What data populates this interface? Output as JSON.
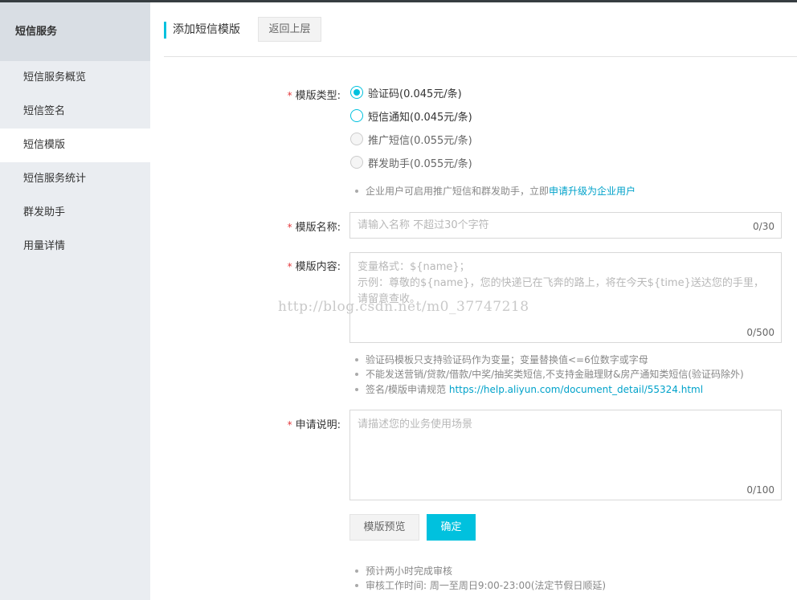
{
  "sidebar": {
    "title": "短信服务",
    "items": [
      {
        "label": "短信服务概览"
      },
      {
        "label": "短信签名"
      },
      {
        "label": "短信模版"
      },
      {
        "label": "短信服务统计"
      },
      {
        "label": "群发助手"
      },
      {
        "label": "用量详情"
      }
    ]
  },
  "header": {
    "title": "添加短信模版",
    "back_label": "返回上层"
  },
  "form": {
    "type": {
      "label": "模版类型:",
      "options": [
        {
          "label": "验证码(0.045元/条)"
        },
        {
          "label": "短信通知(0.045元/条)"
        },
        {
          "label": "推广短信(0.055元/条)"
        },
        {
          "label": "群发助手(0.055元/条)"
        }
      ],
      "tip_prefix": "企业用户可启用推广短信和群发助手，立即",
      "tip_link": "申请升级为企业用户"
    },
    "name": {
      "label": "模版名称:",
      "placeholder": "请输入名称 不超过30个字符",
      "count": "0/30"
    },
    "content": {
      "label": "模版内容:",
      "placeholder_line1": "变量格式：${name}；",
      "placeholder_line2": "示例：尊敬的${name}，您的快递已在飞奔的路上，将在今天${time}送达您的手里，请留意查收。",
      "count": "0/500",
      "tips": [
        {
          "text": "验证码模板只支持验证码作为变量；变量替换值<=6位数字或字母"
        },
        {
          "text": "不能发送营销/贷款/借款/中奖/抽奖类短信,不支持金融理财&房产通知类短信(验证码除外)"
        }
      ],
      "tip3_prefix": "签名/模版申请规范 ",
      "tip3_link": "https://help.aliyun.com/document_detail/55324.html"
    },
    "desc": {
      "label": "申请说明:",
      "placeholder": "请描述您的业务使用场景",
      "count": "0/100"
    },
    "preview_label": "模版预览",
    "submit_label": "确定",
    "bottom_tips": [
      {
        "text": "预计两小时完成审核"
      },
      {
        "text": "审核工作时间: 周一至周日9:00-23:00(法定节假日顺延)"
      }
    ]
  },
  "watermark": "http://blog.csdn.net/m0_37747218",
  "colors": {
    "accent": "#00c1de",
    "link": "#00a2ca",
    "required": "#e4393c"
  }
}
